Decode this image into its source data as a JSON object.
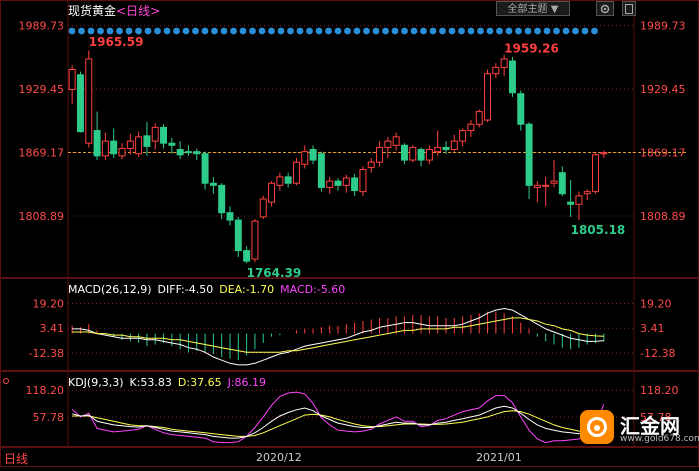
{
  "header": {
    "title": "现货黄金",
    "period": "<日线>",
    "theme_button": "全部主题",
    "theme_caret": "▼"
  },
  "bottom": {
    "tab": "日线"
  },
  "x_axis_labels": [
    "2020/12",
    "2021/01"
  ],
  "watermark": {
    "name": "汇金网",
    "site": "www.gold678.com"
  },
  "colors": {
    "up": "#ff4040",
    "down": "#2ecc8a",
    "axis": "#ff4b4b",
    "dots": "#2a8fd8",
    "grid": "#7a2020"
  },
  "chart_data": [
    {
      "type": "candlestick",
      "title": "现货黄金 <日线>",
      "y_ticks": [
        "1989.73",
        "1929.45",
        "1869.17",
        "1808.89"
      ],
      "ylim": [
        1750,
        1995
      ],
      "current_level": 1869.17,
      "annotations": [
        {
          "text": "1965.59",
          "value": 1965.59,
          "index": 2
        },
        {
          "text": "1959.26",
          "value": 1959.26,
          "index": 52
        },
        {
          "text": "1764.39",
          "value": 1764.39,
          "index": 21
        },
        {
          "text": "1805.18",
          "value": 1805.18,
          "index": 60
        }
      ],
      "candles": [
        [
          1929,
          1948,
          1915,
          1952
        ],
        [
          1943,
          1889,
          1888,
          1946
        ],
        [
          1878,
          1958,
          1874,
          1966
        ],
        [
          1890,
          1866,
          1862,
          1908
        ],
        [
          1866,
          1880,
          1862,
          1888
        ],
        [
          1880,
          1868,
          1864,
          1892
        ],
        [
          1866,
          1873,
          1863,
          1878
        ],
        [
          1873,
          1880,
          1867,
          1887
        ],
        [
          1868,
          1884,
          1865,
          1889
        ],
        [
          1885,
          1875,
          1866,
          1898
        ],
        [
          1880,
          1893,
          1872,
          1897
        ],
        [
          1893,
          1878,
          1873,
          1896
        ],
        [
          1878,
          1876,
          1868,
          1883
        ],
        [
          1872,
          1867,
          1863,
          1880
        ],
        [
          1870,
          1869,
          1866,
          1876
        ],
        [
          1870,
          1868,
          1862,
          1873
        ],
        [
          1868,
          1840,
          1834,
          1870
        ],
        [
          1840,
          1838,
          1830,
          1846
        ],
        [
          1838,
          1812,
          1806,
          1840
        ],
        [
          1812,
          1805,
          1800,
          1818
        ],
        [
          1805,
          1776,
          1770,
          1808
        ],
        [
          1776,
          1766,
          1764,
          1780
        ],
        [
          1768,
          1804,
          1765,
          1806
        ],
        [
          1808,
          1825,
          1806,
          1828
        ],
        [
          1822,
          1840,
          1818,
          1842
        ],
        [
          1838,
          1846,
          1833,
          1850
        ],
        [
          1846,
          1840,
          1836,
          1850
        ],
        [
          1840,
          1860,
          1838,
          1864
        ],
        [
          1858,
          1870,
          1854,
          1876
        ],
        [
          1872,
          1862,
          1858,
          1876
        ],
        [
          1868,
          1836,
          1832,
          1870
        ],
        [
          1836,
          1842,
          1830,
          1846
        ],
        [
          1842,
          1838,
          1833,
          1845
        ],
        [
          1838,
          1845,
          1831,
          1848
        ],
        [
          1845,
          1833,
          1828,
          1849
        ],
        [
          1832,
          1853,
          1828,
          1856
        ],
        [
          1855,
          1860,
          1850,
          1864
        ],
        [
          1860,
          1874,
          1856,
          1880
        ],
        [
          1874,
          1880,
          1864,
          1884
        ],
        [
          1876,
          1884,
          1871,
          1888
        ],
        [
          1876,
          1862,
          1858,
          1878
        ],
        [
          1862,
          1874,
          1860,
          1876
        ],
        [
          1872,
          1862,
          1856,
          1874
        ],
        [
          1862,
          1872,
          1858,
          1876
        ],
        [
          1870,
          1874,
          1866,
          1890
        ],
        [
          1874,
          1872,
          1868,
          1880
        ],
        [
          1872,
          1880,
          1870,
          1886
        ],
        [
          1880,
          1890,
          1875,
          1892
        ],
        [
          1890,
          1896,
          1884,
          1900
        ],
        [
          1896,
          1908,
          1893,
          1910
        ],
        [
          1900,
          1944,
          1898,
          1948
        ],
        [
          1944,
          1950,
          1940,
          1954
        ],
        [
          1950,
          1958,
          1942,
          1962
        ],
        [
          1956,
          1926,
          1922,
          1960
        ],
        [
          1925,
          1896,
          1890,
          1928
        ],
        [
          1896,
          1838,
          1825,
          1898
        ],
        [
          1836,
          1838,
          1822,
          1842
        ],
        [
          1838,
          1838,
          1818,
          1846
        ],
        [
          1840,
          1842,
          1836,
          1862
        ],
        [
          1850,
          1830,
          1828,
          1856
        ],
        [
          1822,
          1820,
          1808,
          1843
        ],
        [
          1820,
          1828,
          1805,
          1832
        ],
        [
          1830,
          1832,
          1824,
          1834
        ],
        [
          1832,
          1867,
          1830,
          1869
        ],
        [
          1868,
          1869,
          1864,
          1871
        ]
      ]
    },
    {
      "type": "bar+line",
      "title": "MACD(26,12,9)",
      "series_labels": {
        "diff": "DIFF:-4.50",
        "dea": "DEA:-1.70",
        "macd": "MACD:-5.60"
      },
      "y_ticks": [
        "19.20",
        "3.41",
        "-12.38"
      ],
      "ylim": [
        -22,
        24
      ],
      "macd": [
        5,
        4,
        6,
        2,
        0,
        -2,
        -4,
        -5,
        -6,
        -8,
        -7,
        -6,
        -8,
        -10,
        -12,
        -11,
        -12,
        -13,
        -15,
        -16,
        -17,
        -14,
        -10,
        -6,
        -2,
        -1,
        0,
        2,
        3,
        3,
        4,
        5,
        5,
        6,
        7,
        8,
        9,
        10,
        10,
        11,
        11,
        12,
        12,
        11,
        11,
        10,
        10,
        11,
        12,
        13,
        14,
        14,
        13,
        11,
        7,
        3,
        -2,
        -5,
        -7,
        -9,
        -10,
        -9,
        -7,
        -6,
        -5
      ],
      "diff": [
        3,
        3,
        2,
        0,
        -1,
        -2,
        -3,
        -3,
        -3,
        -4,
        -4,
        -5,
        -6,
        -7,
        -9,
        -10,
        -12,
        -15,
        -17,
        -19,
        -20,
        -20,
        -19,
        -17,
        -15,
        -13,
        -12,
        -10,
        -8,
        -7,
        -6,
        -5,
        -4,
        -3,
        -1,
        1,
        2,
        4,
        5,
        6,
        7,
        7,
        6,
        5,
        5,
        5,
        5,
        6,
        8,
        10,
        13,
        15,
        16,
        15,
        12,
        9,
        6,
        3,
        1,
        -1,
        -3,
        -4,
        -5,
        -5,
        -4.5
      ],
      "dea": [
        1,
        1,
        1,
        0,
        0,
        -1,
        -1,
        -2,
        -2,
        -3,
        -3,
        -3,
        -4,
        -4,
        -5,
        -6,
        -7,
        -8,
        -9,
        -10,
        -11,
        -12,
        -12,
        -12,
        -12,
        -12,
        -11,
        -11,
        -10,
        -9,
        -8,
        -7,
        -6,
        -5,
        -4,
        -3,
        -2,
        -1,
        0,
        1,
        2,
        2,
        3,
        3,
        3,
        3,
        4,
        4,
        5,
        6,
        7,
        8,
        9,
        10,
        10,
        9,
        8,
        6,
        5,
        3,
        2,
        0,
        -1,
        -1.5,
        -1.7
      ]
    },
    {
      "type": "line",
      "title": "KDJ(9,3,3)",
      "series_labels": {
        "k": "K:53.83",
        "d": "D:37.65",
        "j": "J:86.19"
      },
      "y_ticks": [
        "118.20",
        "57.78"
      ],
      "ylim": [
        -10,
        130
      ],
      "k": [
        65,
        60,
        62,
        48,
        44,
        40,
        38,
        36,
        35,
        38,
        34,
        30,
        26,
        24,
        22,
        20,
        18,
        14,
        12,
        10,
        10,
        14,
        22,
        34,
        48,
        60,
        68,
        74,
        78,
        72,
        60,
        52,
        44,
        40,
        36,
        34,
        34,
        38,
        42,
        46,
        44,
        44,
        40,
        40,
        44,
        46,
        50,
        54,
        58,
        62,
        70,
        78,
        82,
        78,
        66,
        52,
        40,
        32,
        28,
        24,
        22,
        20,
        22,
        30,
        53.83
      ],
      "d": [
        60,
        60,
        60,
        56,
        52,
        48,
        44,
        40,
        38,
        38,
        36,
        34,
        30,
        28,
        26,
        24,
        22,
        20,
        18,
        16,
        14,
        14,
        16,
        22,
        30,
        38,
        46,
        54,
        62,
        64,
        62,
        58,
        52,
        47,
        42,
        38,
        36,
        36,
        38,
        40,
        42,
        42,
        42,
        41,
        41,
        42,
        44,
        46,
        50,
        54,
        58,
        64,
        70,
        72,
        70,
        64,
        56,
        48,
        40,
        34,
        30,
        26,
        24,
        26,
        37.65
      ],
      "j": [
        75,
        58,
        66,
        32,
        28,
        24,
        26,
        28,
        30,
        38,
        30,
        22,
        18,
        16,
        14,
        12,
        10,
        2,
        0,
        0,
        2,
        14,
        34,
        58,
        84,
        104,
        112,
        114,
        110,
        88,
        56,
        40,
        28,
        26,
        24,
        26,
        30,
        42,
        50,
        58,
        48,
        48,
        36,
        38,
        50,
        54,
        62,
        70,
        74,
        78,
        94,
        106,
        106,
        90,
        58,
        28,
        8,
        0,
        4,
        4,
        6,
        8,
        18,
        38,
        86.19
      ]
    }
  ]
}
